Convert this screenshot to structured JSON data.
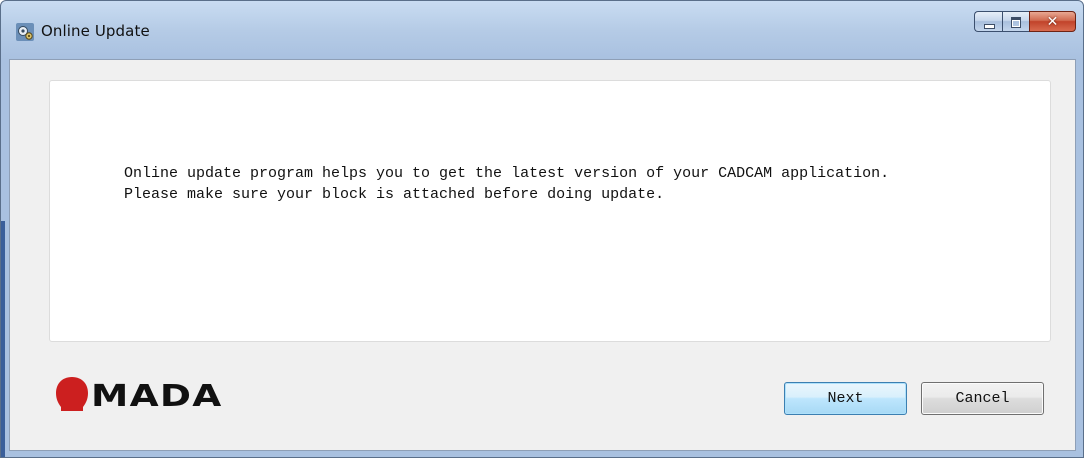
{
  "window": {
    "title": "Online Update",
    "icon": "gears-icon"
  },
  "caption_buttons": {
    "minimize": "minimize-icon",
    "maximize": "maximize-icon",
    "close": "close-icon"
  },
  "message": {
    "line1": "Online update program helps you to get the latest version of your CADCAM application.",
    "line2": "Please make sure your block is attached before doing update."
  },
  "logo": {
    "text": "MADA",
    "color": "#cc1f1f"
  },
  "buttons": {
    "next_label": "Next",
    "cancel_label": "Cancel"
  }
}
